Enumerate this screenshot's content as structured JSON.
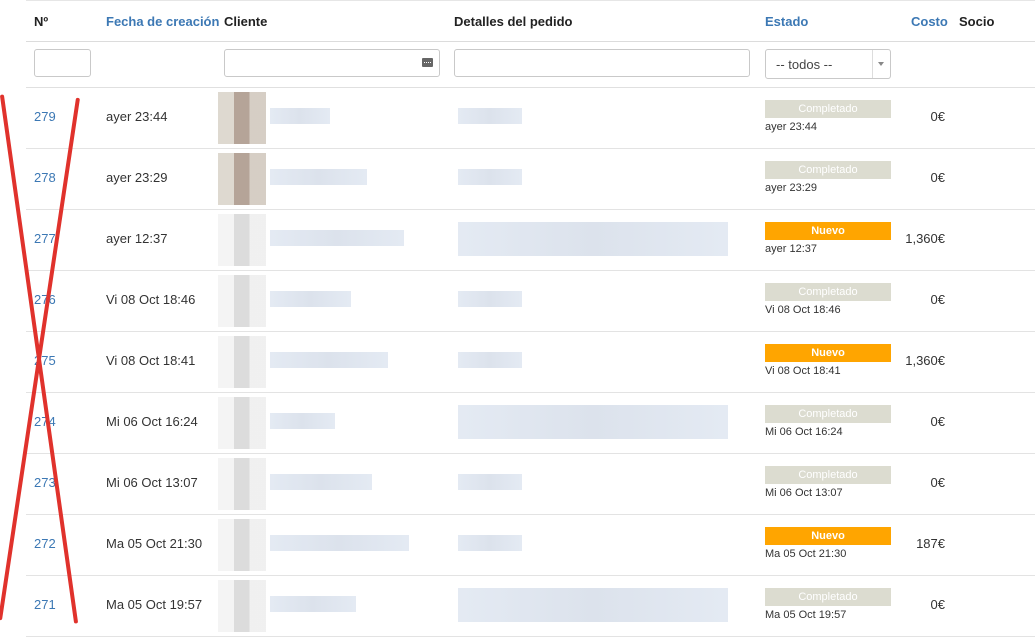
{
  "header": {
    "num": "Nº",
    "created": "Fecha de creación",
    "client": "Cliente",
    "details": "Detalles del pedido",
    "status": "Estado",
    "cost": "Costo",
    "partner": "Socio"
  },
  "filters": {
    "num_value": "",
    "client_value": "",
    "details_value": "",
    "status_selected": "-- todos --"
  },
  "colors": {
    "link": "#3c78b4",
    "completed_badge": "#dcdcd0",
    "new_badge": "#ffa500",
    "annotation_cross": "#e0322c"
  },
  "rows": [
    {
      "num": "279",
      "created": "ayer 23:44",
      "status": "Completado",
      "status_type": "completed",
      "status_time": "ayer 23:44",
      "cost": "0€"
    },
    {
      "num": "278",
      "created": "ayer 23:29",
      "status": "Completado",
      "status_type": "completed",
      "status_time": "ayer 23:29",
      "cost": "0€"
    },
    {
      "num": "277",
      "created": "ayer 12:37",
      "status": "Nuevo",
      "status_type": "new",
      "status_time": "ayer 12:37",
      "cost": "1,360€"
    },
    {
      "num": "276",
      "created": "Vi 08 Oct 18:46",
      "status": "Completado",
      "status_type": "completed",
      "status_time": "Vi 08 Oct 18:46",
      "cost": "0€"
    },
    {
      "num": "275",
      "created": "Vi 08 Oct 18:41",
      "status": "Nuevo",
      "status_type": "new",
      "status_time": "Vi 08 Oct 18:41",
      "cost": "1,360€"
    },
    {
      "num": "274",
      "created": "Mi 06 Oct 16:24",
      "status": "Completado",
      "status_type": "completed",
      "status_time": "Mi 06 Oct 16:24",
      "cost": "0€"
    },
    {
      "num": "273",
      "created": "Mi 06 Oct 13:07",
      "status": "Completado",
      "status_type": "completed",
      "status_time": "Mi 06 Oct 13:07",
      "cost": "0€"
    },
    {
      "num": "272",
      "created": "Ma 05 Oct 21:30",
      "status": "Nuevo",
      "status_type": "new",
      "status_time": "Ma 05 Oct 21:30",
      "cost": "187€"
    },
    {
      "num": "271",
      "created": "Ma 05 Oct 19:57",
      "status": "Completado",
      "status_type": "completed",
      "status_time": "Ma 05 Oct 19:57",
      "cost": "0€"
    }
  ]
}
